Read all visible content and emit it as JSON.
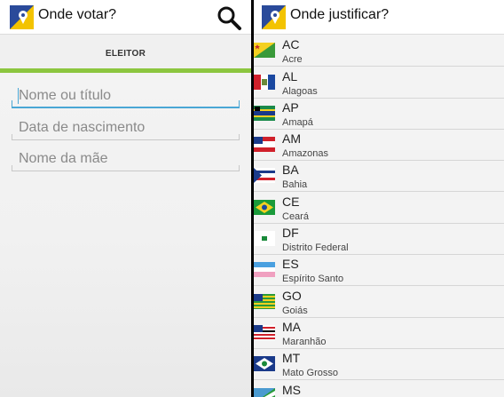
{
  "left_screen": {
    "title": "Onde votar?",
    "tab_label": "ELEITOR",
    "fields": [
      {
        "placeholder": "Nome ou título",
        "value": ""
      },
      {
        "placeholder": "Data de nascimento",
        "value": ""
      },
      {
        "placeholder": "Nome da mãe",
        "value": ""
      }
    ],
    "icons": {
      "app": "app-logo-icon",
      "search": "search-icon"
    },
    "colors": {
      "accent": "#8cc63f",
      "focus": "#4aa7d5"
    }
  },
  "right_screen": {
    "title": "Onde justificar?",
    "states": [
      {
        "code": "AC",
        "name": "Acre"
      },
      {
        "code": "AL",
        "name": "Alagoas"
      },
      {
        "code": "AP",
        "name": "Amapá"
      },
      {
        "code": "AM",
        "name": "Amazonas"
      },
      {
        "code": "BA",
        "name": "Bahia"
      },
      {
        "code": "CE",
        "name": "Ceará"
      },
      {
        "code": "DF",
        "name": "Distrito Federal"
      },
      {
        "code": "ES",
        "name": "Espírito Santo"
      },
      {
        "code": "GO",
        "name": "Goiás"
      },
      {
        "code": "MA",
        "name": "Maranhão"
      },
      {
        "code": "MT",
        "name": "Mato Grosso"
      },
      {
        "code": "MS",
        "name": ""
      }
    ]
  }
}
